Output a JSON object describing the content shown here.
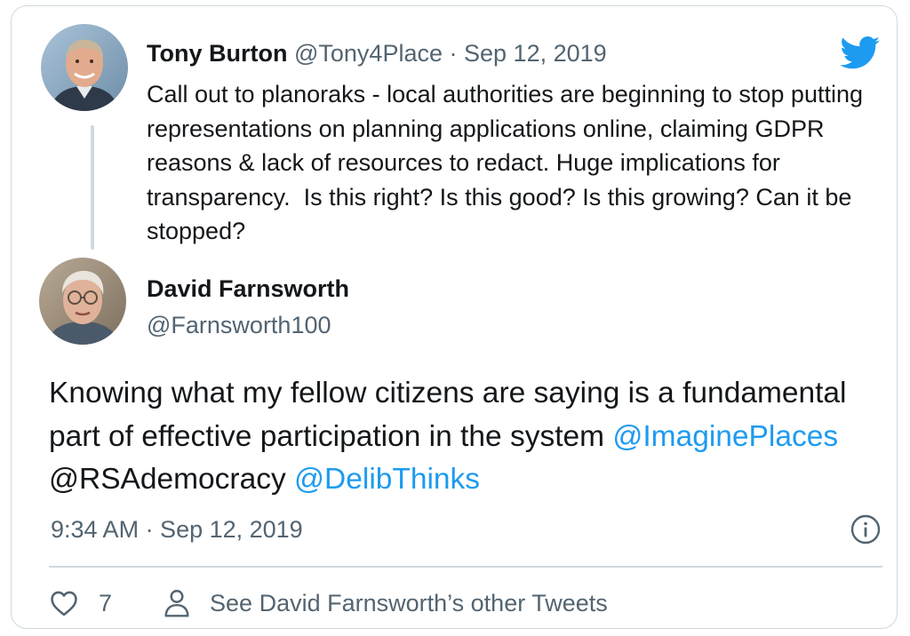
{
  "quoted": {
    "author_name": "Tony Burton",
    "author_handle": "@Tony4Place",
    "separator": "·",
    "date": "Sep 12, 2019",
    "text": "Call out to planoraks - local authorities are beginning to stop putting representations on planning applications online, claiming GDPR reasons & lack of resources to redact. Huge implications for transparency.  Is this right? Is this good? Is this growing? Can it be stopped?"
  },
  "main": {
    "author_name": "David Farnsworth",
    "author_handle": "@Farnsworth100",
    "text_part1": "Knowing what my fellow citizens are saying is a fundamental part of effective participation in the system",
    "mention1": "@ImaginePlaces",
    "text_part2": "@RSAdemocracy",
    "mention2": "@DelibThinks",
    "timestamp": "9:34 AM · Sep 12, 2019"
  },
  "actions": {
    "like_count": "7",
    "other_tweets_label": "See David Farnsworth’s other Tweets"
  },
  "icons": {
    "brand": "twitter-bird-icon",
    "info": "info-icon",
    "like": "heart-icon",
    "profile": "person-icon"
  },
  "colors": {
    "link": "#1d9bf0",
    "secondary_text": "#536471",
    "border": "#cfd9de",
    "brand": "#1d9bf0"
  }
}
